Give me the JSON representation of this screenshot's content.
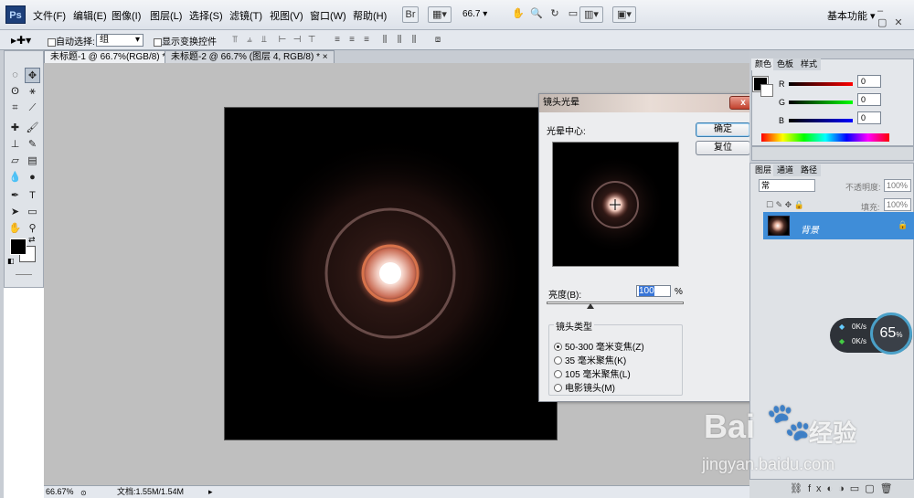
{
  "app": {
    "logo": "Ps",
    "workspace": "基本功能"
  },
  "menu": [
    "文件(F)",
    "编辑(E)",
    "图像(I)",
    "图层(L)",
    "选择(S)",
    "滤镜(T)",
    "视图(V)",
    "窗口(W)",
    "帮助(H)"
  ],
  "toolbar": {
    "zoom": "66.7"
  },
  "options": {
    "auto_select_label": "自动选择:",
    "auto_select_value": "组",
    "show_transform_label": "显示变换控件"
  },
  "tabs": [
    {
      "label": "未标题-1 @ 66.7%(RGB/8) *",
      "close": "×"
    },
    {
      "label": "未标题-2 @ 66.7% (图层 4, RGB/8) *",
      "close": "×"
    }
  ],
  "status": {
    "zoom": "66.67%",
    "doc": "文档:1.55M/1.54M"
  },
  "dialog": {
    "title": "镜头光晕",
    "close": "x",
    "flare_center_label": "光晕中心:",
    "ok": "确定",
    "reset": "复位",
    "brightness_label": "亮度(B):",
    "brightness_value": "100",
    "brightness_unit": "%",
    "brightness_fraction": 1.0,
    "lens_type_label": "镜头类型",
    "lens_options": [
      "50-300 毫米变焦(Z)",
      "35 毫米聚焦(K)",
      "105 毫米聚焦(L)",
      "电影镜头(M)"
    ],
    "selected_lens": 0
  },
  "color_panel": {
    "tabs": [
      "颜色",
      "色板",
      "样式"
    ],
    "channels": [
      {
        "name": "R",
        "value": "0",
        "color": "#d00000"
      },
      {
        "name": "G",
        "value": "0",
        "color": "#00a000"
      },
      {
        "name": "B",
        "value": "0",
        "color": "#0000d0"
      }
    ]
  },
  "layers_panel": {
    "tabs": [
      "图层",
      "通道",
      "路径"
    ],
    "blend_mode": "常",
    "opacity_label": "不透明度:",
    "opacity_value": "100%",
    "fill_label": "填充:",
    "fill_value": "100%",
    "layer_name": "背景"
  },
  "net_widget": {
    "up": "0K/s",
    "down": "0K/s",
    "percent": "65",
    "percent_unit": "%"
  },
  "watermark": {
    "brand": "Bai",
    "brand_cn": "经验",
    "url": "jingyan.baidu.com"
  }
}
